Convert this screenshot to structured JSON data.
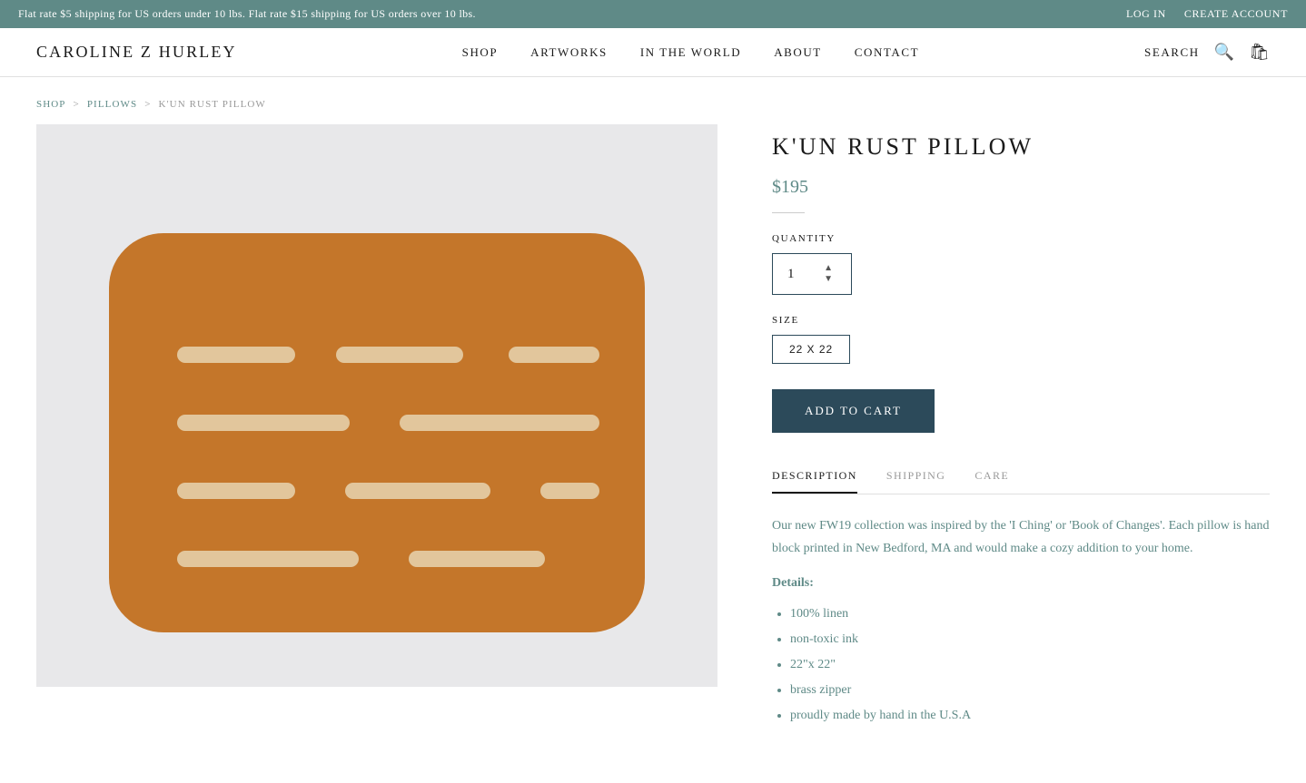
{
  "banner": {
    "message": "Flat rate $5 shipping for US orders under 10 lbs. Flat rate $15 shipping for US orders over 10 lbs.",
    "log_in": "LOG IN",
    "create_account": "CREATE ACCOUNT"
  },
  "header": {
    "logo": "CAROLINE Z HURLEY",
    "nav": [
      {
        "label": "SHOP",
        "id": "shop"
      },
      {
        "label": "ARTWORKS",
        "id": "artworks"
      },
      {
        "label": "IN THE WORLD",
        "id": "in-the-world"
      },
      {
        "label": "ABOUT",
        "id": "about"
      },
      {
        "label": "CONTACT",
        "id": "contact"
      }
    ],
    "search_label": "SEARCH"
  },
  "breadcrumb": {
    "items": [
      {
        "label": "SHOP",
        "id": "bc-shop"
      },
      {
        "label": "PILLOWS",
        "id": "bc-pillows"
      },
      {
        "label": "K'UN RUST PILLOW",
        "id": "bc-current"
      }
    ]
  },
  "product": {
    "title": "K'UN RUST PILLOW",
    "price": "$195",
    "quantity_label": "QUANTITY",
    "quantity_value": "1",
    "size_label": "SIZE",
    "sizes": [
      {
        "label": "22 X 22",
        "selected": true
      }
    ],
    "add_to_cart": "ADD TO CART",
    "tabs": [
      {
        "label": "DESCRIPTION",
        "id": "desc",
        "active": true
      },
      {
        "label": "SHIPPING",
        "id": "ship",
        "active": false
      },
      {
        "label": "CARE",
        "id": "care",
        "active": false
      }
    ],
    "description": "Our new FW19 collection was inspired by the 'I Ching' or 'Book of Changes'. Each pillow is hand block printed in New Bedford, MA and would make a cozy addition to your home.",
    "details_heading": "Details:",
    "details": [
      "100% linen",
      "non-toxic ink",
      "22\"x 22\"",
      "brass zipper",
      "proudly made by hand in the U.S.A"
    ]
  }
}
